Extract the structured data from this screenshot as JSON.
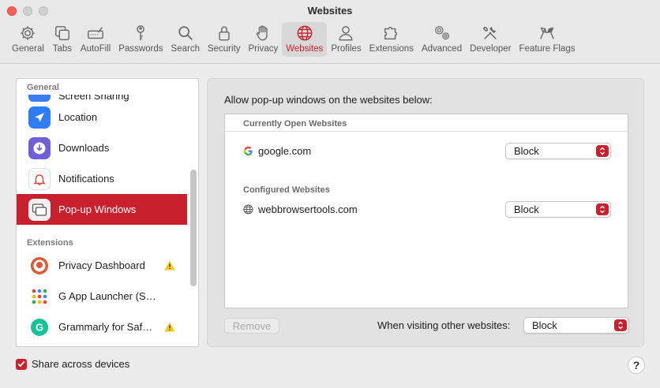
{
  "window": {
    "title": "Websites"
  },
  "toolbar": {
    "items": [
      {
        "label": "General",
        "icon": "gear-icon"
      },
      {
        "label": "Tabs",
        "icon": "tabs-icon"
      },
      {
        "label": "AutoFill",
        "icon": "autofill-icon"
      },
      {
        "label": "Passwords",
        "icon": "key-icon"
      },
      {
        "label": "Search",
        "icon": "search-icon"
      },
      {
        "label": "Security",
        "icon": "lock-icon"
      },
      {
        "label": "Privacy",
        "icon": "hand-icon"
      },
      {
        "label": "Websites",
        "icon": "globe-icon",
        "active": true
      },
      {
        "label": "Profiles",
        "icon": "person-icon"
      },
      {
        "label": "Extensions",
        "icon": "puzzle-icon"
      },
      {
        "label": "Advanced",
        "icon": "gears-icon"
      },
      {
        "label": "Developer",
        "icon": "tools-icon"
      },
      {
        "label": "Feature Flags",
        "icon": "flags-icon"
      }
    ]
  },
  "sidebar": {
    "general_header": "General",
    "items": [
      {
        "label": "Screen Sharing",
        "icon": "screen-sharing-icon",
        "partial": true
      },
      {
        "label": "Location",
        "icon": "location-icon"
      },
      {
        "label": "Downloads",
        "icon": "downloads-icon"
      },
      {
        "label": "Notifications",
        "icon": "notifications-icon"
      },
      {
        "label": "Pop-up Windows",
        "icon": "popup-windows-icon",
        "selected": true
      }
    ],
    "extensions_header": "Extensions",
    "extensions": [
      {
        "label": "Privacy Dashboard",
        "icon": "duckduckgo-icon",
        "warning": true
      },
      {
        "label": "G App Launcher (Shor…",
        "icon": "app-launcher-icon",
        "warning": false
      },
      {
        "label": "Grammarly for Saf…",
        "icon": "grammarly-icon",
        "warning": true
      }
    ]
  },
  "main": {
    "title": "Allow pop-up windows on the websites below:",
    "currently_open_header": "Currently Open Websites",
    "configured_header": "Configured Websites",
    "open_sites": [
      {
        "domain": "google.com",
        "setting": "Block",
        "icon": "google-icon"
      }
    ],
    "configured_sites": [
      {
        "domain": "webbrowsertools.com",
        "setting": "Block",
        "icon": "globe-icon"
      }
    ],
    "remove_label": "Remove",
    "other_label": "When visiting other websites:",
    "other_setting": "Block"
  },
  "footer": {
    "share_label": "Share across devices",
    "share_checked": true,
    "help_label": "?"
  },
  "colors": {
    "accent": "#c8202c"
  }
}
